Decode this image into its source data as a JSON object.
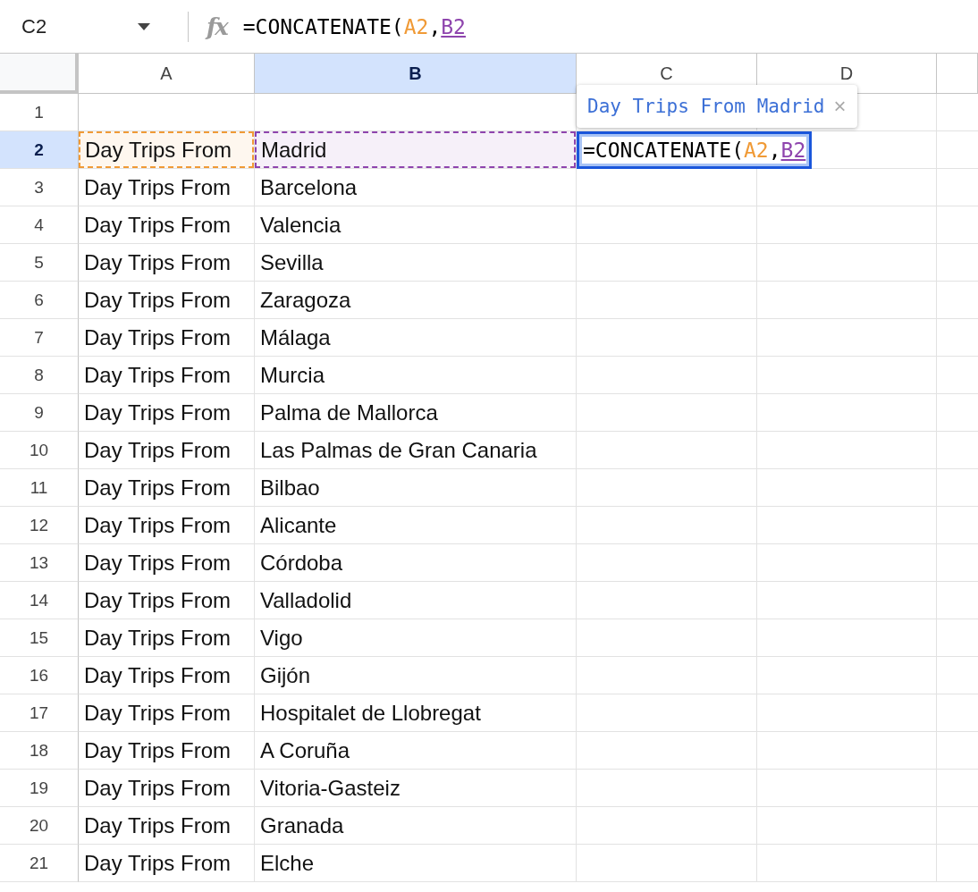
{
  "formula_bar": {
    "name_box": "C2",
    "function_label": "fx",
    "formula": [
      {
        "text": "=CONCATENATE(",
        "color": "#000000",
        "underlined": false
      },
      {
        "text": "A2",
        "color": "#f09a36",
        "underlined": false
      },
      {
        "text": ",",
        "color": "#000000",
        "underlined": false
      },
      {
        "text": "B2",
        "color": "#8e44ad",
        "underlined": true
      }
    ]
  },
  "columns": [
    {
      "label": "A",
      "selected": false
    },
    {
      "label": "B",
      "selected": true
    },
    {
      "label": "C",
      "selected": false
    },
    {
      "label": "D",
      "selected": false
    }
  ],
  "rows": [
    {
      "number": "1",
      "selected": false,
      "cells": []
    },
    {
      "number": "2",
      "selected": true,
      "cells": [
        {
          "text": "Day Trips From",
          "color": "#f09a36"
        },
        {
          "text": "Madrid",
          "color": "#8e44ad"
        }
      ],
      "editor": {
        "formula": [
          {
            "text": "=CONCATENATE(",
            "color": "#000000",
            "underlined": false
          },
          {
            "text": "A2",
            "color": "#f09a36",
            "underlined": false
          },
          {
            "text": ",",
            "color": "#000000",
            "underlined": false
          },
          {
            "text": "B2",
            "color": "#8e44ad",
            "underlined": true
          }
        ],
        "preview": {
          "text": "Day Trips From Madrid",
          "close": "×"
        }
      }
    },
    {
      "number": "3",
      "selected": false,
      "cells": [
        {
          "text": "Day Trips From"
        },
        {
          "text": "Barcelona"
        }
      ]
    },
    {
      "number": "4",
      "selected": false,
      "cells": [
        {
          "text": "Day Trips From"
        },
        {
          "text": "Valencia"
        }
      ]
    },
    {
      "number": "5",
      "selected": false,
      "cells": [
        {
          "text": "Day Trips From"
        },
        {
          "text": "Sevilla"
        }
      ]
    },
    {
      "number": "6",
      "selected": false,
      "cells": [
        {
          "text": "Day Trips From"
        },
        {
          "text": "Zaragoza"
        }
      ]
    },
    {
      "number": "7",
      "selected": false,
      "cells": [
        {
          "text": "Day Trips From"
        },
        {
          "text": "Málaga"
        }
      ]
    },
    {
      "number": "8",
      "selected": false,
      "cells": [
        {
          "text": "Day Trips From"
        },
        {
          "text": "Murcia"
        }
      ]
    },
    {
      "number": "9",
      "selected": false,
      "cells": [
        {
          "text": "Day Trips From"
        },
        {
          "text": "Palma de Mallorca"
        }
      ]
    },
    {
      "number": "10",
      "selected": false,
      "cells": [
        {
          "text": "Day Trips From"
        },
        {
          "text": "Las Palmas de Gran Canaria"
        }
      ]
    },
    {
      "number": "11",
      "selected": false,
      "cells": [
        {
          "text": "Day Trips From"
        },
        {
          "text": "Bilbao"
        }
      ]
    },
    {
      "number": "12",
      "selected": false,
      "cells": [
        {
          "text": "Day Trips From"
        },
        {
          "text": "Alicante"
        }
      ]
    },
    {
      "number": "13",
      "selected": false,
      "cells": [
        {
          "text": "Day Trips From"
        },
        {
          "text": "Córdoba"
        }
      ]
    },
    {
      "number": "14",
      "selected": false,
      "cells": [
        {
          "text": "Day Trips From"
        },
        {
          "text": "Valladolid"
        }
      ]
    },
    {
      "number": "15",
      "selected": false,
      "cells": [
        {
          "text": "Day Trips From"
        },
        {
          "text": "Vigo"
        }
      ]
    },
    {
      "number": "16",
      "selected": false,
      "cells": [
        {
          "text": "Day Trips From"
        },
        {
          "text": "Gijón"
        }
      ]
    },
    {
      "number": "17",
      "selected": false,
      "cells": [
        {
          "text": "Day Trips From"
        },
        {
          "text": "Hospitalet de Llobregat"
        }
      ]
    },
    {
      "number": "18",
      "selected": false,
      "cells": [
        {
          "text": "Day Trips From"
        },
        {
          "text": "A Coruña"
        }
      ]
    },
    {
      "number": "19",
      "selected": false,
      "cells": [
        {
          "text": "Day Trips From"
        },
        {
          "text": "Vitoria-Gasteiz"
        }
      ]
    },
    {
      "number": "20",
      "selected": false,
      "cells": [
        {
          "text": "Day Trips From"
        },
        {
          "text": "Granada"
        }
      ]
    },
    {
      "number": "21",
      "selected": false,
      "cells": [
        {
          "text": "Day Trips From"
        },
        {
          "text": "Elche"
        }
      ]
    }
  ]
}
